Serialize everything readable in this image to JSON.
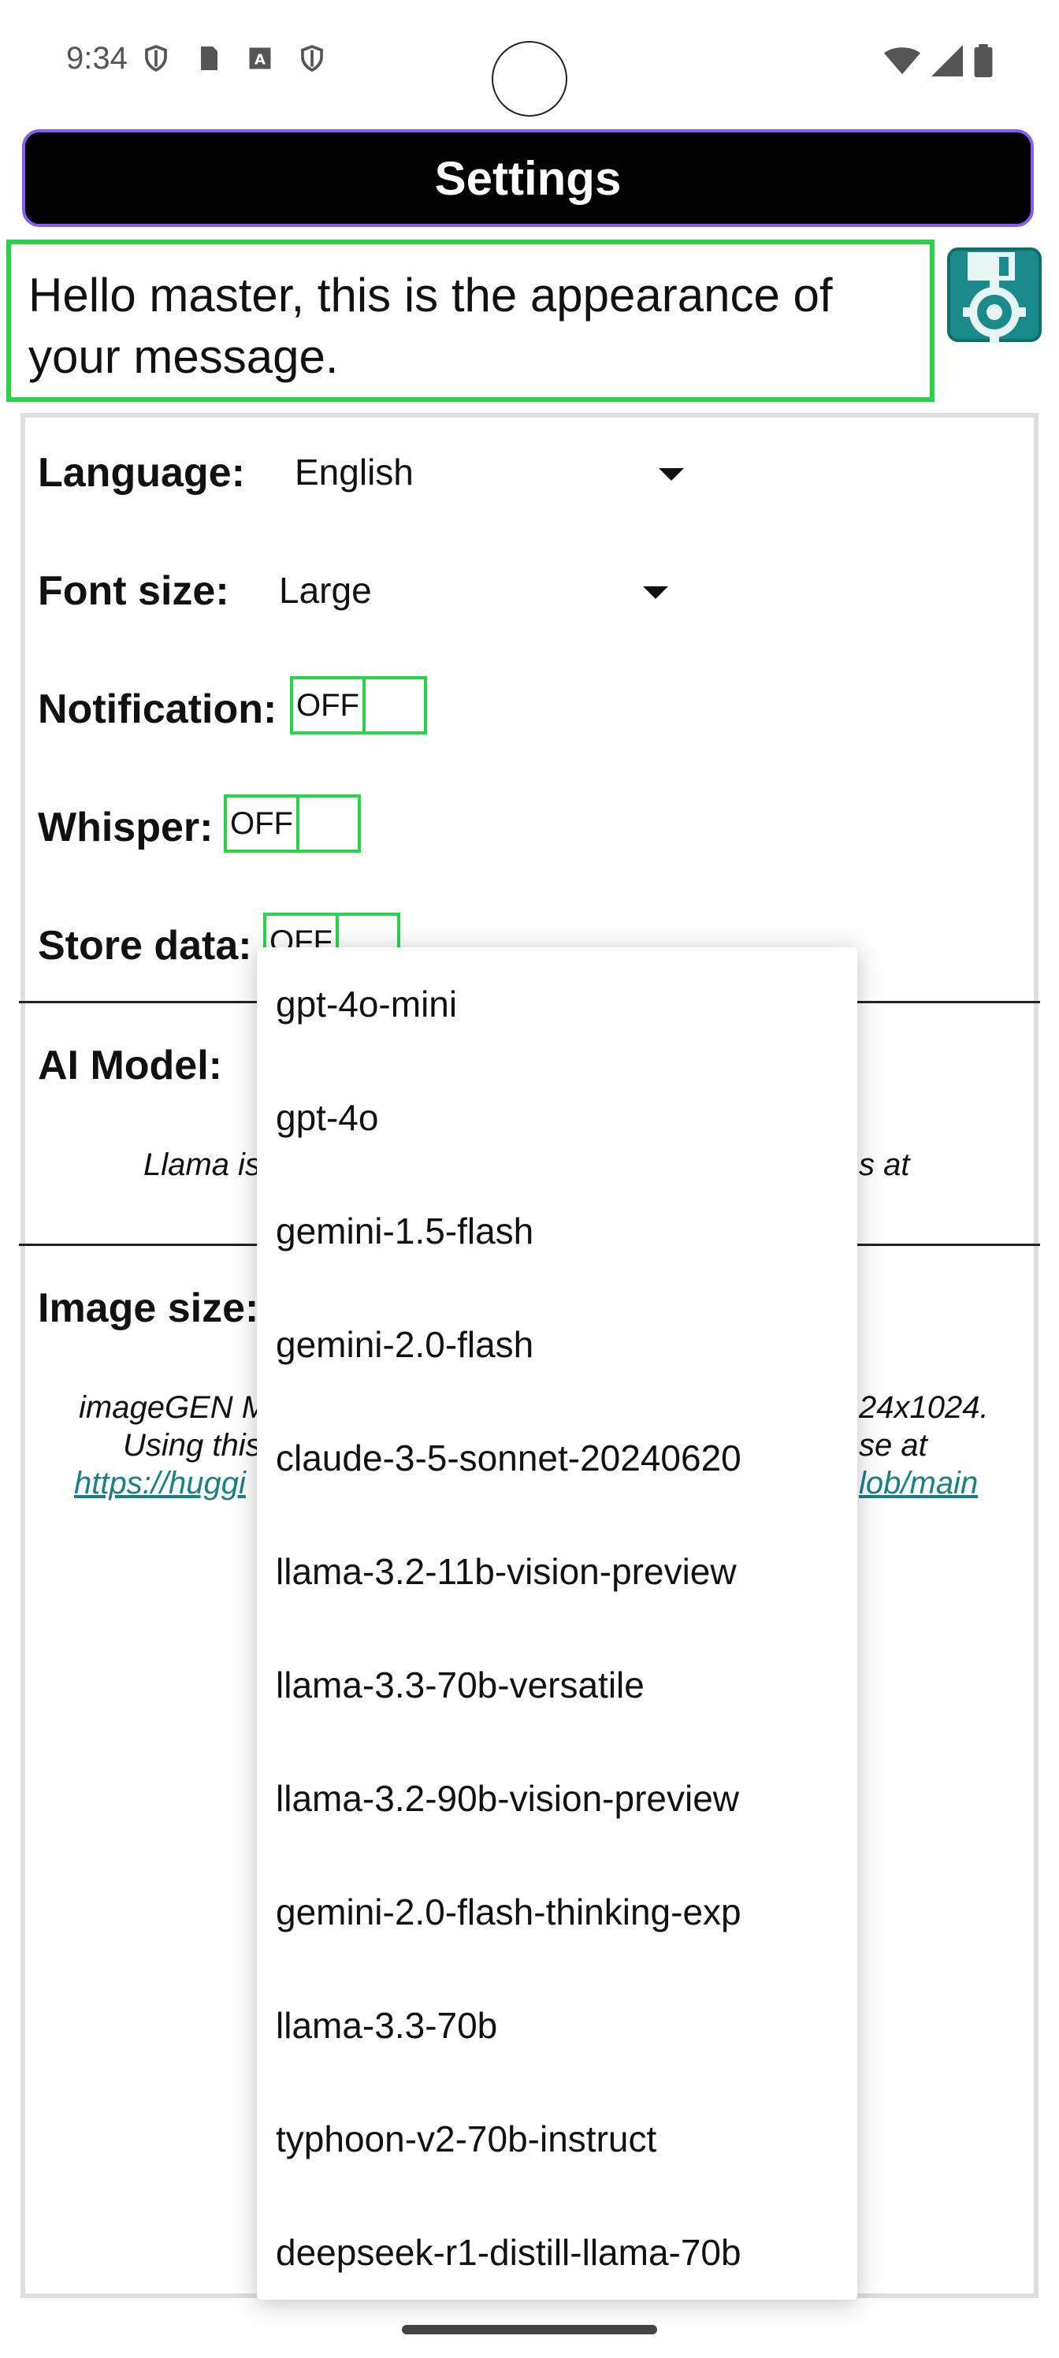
{
  "status_bar": {
    "time": "9:34"
  },
  "header": {
    "title": "Settings"
  },
  "preview": {
    "text": "Hello master, this is the appearance of your message."
  },
  "settings": {
    "language_label": "Language:",
    "language_value": "English",
    "font_size_label": "Font size:",
    "font_size_value": "Large",
    "notification_label": "Notification:",
    "notification_state": "OFF",
    "whisper_label": "Whisper:",
    "whisper_state": "OFF",
    "store_data_label": "Store data:",
    "store_data_state": "OFF",
    "ai_model_label": "AI Model:",
    "ai_note_left": "Llama is",
    "ai_note_right": "s at",
    "image_size_label": "Image size:",
    "image_note_line1_left": "imageGEN M",
    "image_note_line1_right": "24x1024.",
    "image_note_line2_left": "Using this",
    "image_note_line2_right": "se at",
    "image_link_left": "https://huggi",
    "image_link_right": "lob/main"
  },
  "dropdown": {
    "options": [
      "gpt-4o-mini",
      "gpt-4o",
      "gemini-1.5-flash",
      "gemini-2.0-flash",
      "claude-3-5-sonnet-20240620",
      "llama-3.2-11b-vision-preview",
      "llama-3.3-70b-versatile",
      "llama-3.2-90b-vision-preview",
      "gemini-2.0-flash-thinking-exp",
      "llama-3.3-70b",
      "typhoon-v2-70b-instruct",
      "deepseek-r1-distill-llama-70b"
    ]
  },
  "colors": {
    "accent_green": "#2ad44a",
    "title_border": "#8a5cf0",
    "link": "#1a7f86"
  }
}
